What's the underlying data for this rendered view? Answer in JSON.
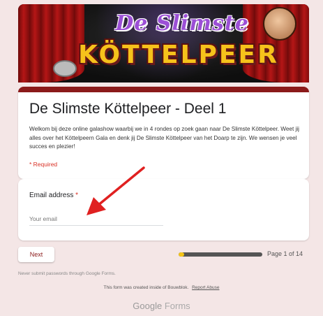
{
  "banner": {
    "title_top": "De Slimste",
    "title_main": "KÖTTELPEER"
  },
  "form": {
    "title": "De Slimste Köttelpeer - Deel 1",
    "description": "Welkom bij deze online galashow waarbij we in 4 rondes op zoek gaan naar De Slimste Köttelpeer. Weet jij alles over het Köttelpeern Gala en denk jij De Slimste Köttelpeer van het Doarp te zijn. We wensen je veel succes en plezier!",
    "required_note": "* Required"
  },
  "email": {
    "label": "Email address",
    "required_mark": "*",
    "placeholder": "Your email",
    "value": ""
  },
  "navigation": {
    "next_label": "Next",
    "progress": 0.07,
    "page_label": "Page 1 of 14"
  },
  "footer": {
    "never_submit": "Never submit passwords through Google Forms.",
    "created_text": "This form was created inside of Bouwblok.",
    "report_abuse": "Report Abuse",
    "brand_google": "Google",
    "brand_forms": "Forms"
  },
  "colors": {
    "accent": "#8b1a1a",
    "background": "#f4e6e6",
    "required": "#d93025",
    "progress_fill": "#f5c518"
  }
}
